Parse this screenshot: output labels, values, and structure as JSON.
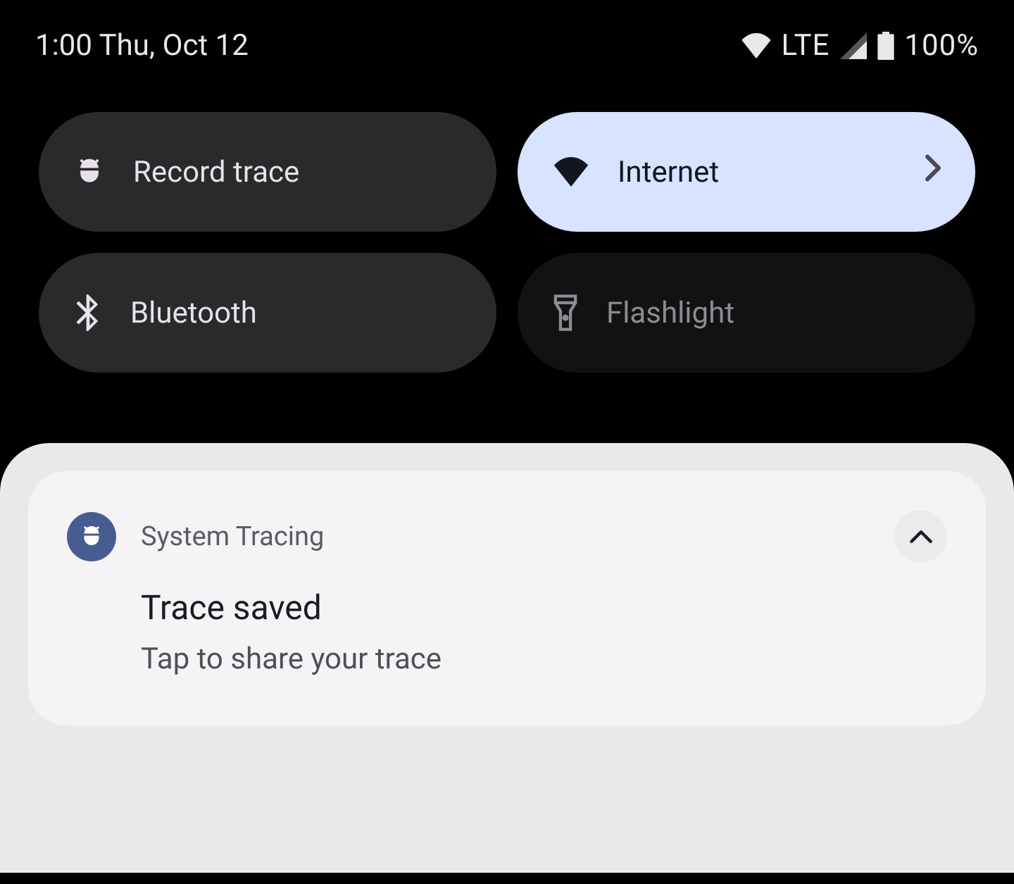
{
  "status": {
    "time_date": "1:00 Thu, Oct 12",
    "network_type": "LTE",
    "battery": "100%"
  },
  "tiles": [
    {
      "icon": "bug-icon",
      "label": "Record trace",
      "state": "inactive",
      "chevron": false
    },
    {
      "icon": "wifi-icon",
      "label": "Internet",
      "state": "active",
      "chevron": true
    },
    {
      "icon": "bluetooth-icon",
      "label": "Bluetooth",
      "state": "inactive",
      "chevron": false
    },
    {
      "icon": "flashlight-icon",
      "label": "Flashlight",
      "state": "disabled",
      "chevron": false
    }
  ],
  "notification": {
    "app_name": "System Tracing",
    "title": "Trace saved",
    "text": "Tap to share your trace"
  }
}
